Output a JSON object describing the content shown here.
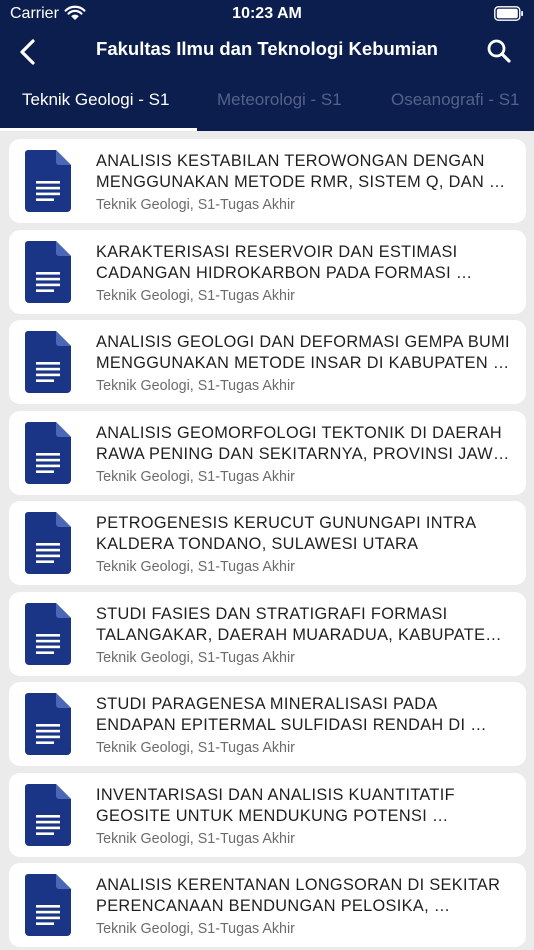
{
  "status_bar": {
    "carrier": "Carrier",
    "time": "10:23 AM"
  },
  "nav": {
    "title": "Fakultas Ilmu dan Teknologi Kebumian"
  },
  "tabs": [
    {
      "label": "Teknik Geologi - S1",
      "active": true
    },
    {
      "label": "Meteorologi - S1",
      "active": false
    },
    {
      "label": "Oseanografi - S1",
      "active": false
    }
  ],
  "colors": {
    "header_bg": "#0c1e4d",
    "doc_icon": "#1a3586",
    "list_bg": "#ebebeb"
  },
  "items": [
    {
      "title_line1": "ANALISIS KESTABILAN TEROWONGAN DENGAN",
      "title_line2": "MENGGUNAKAN METODE RMR, SISTEM Q, DAN …",
      "subtitle": "Teknik Geologi, S1-Tugas Akhir"
    },
    {
      "title_line1": "KARAKTERISASI RESERVOIR DAN ESTIMASI",
      "title_line2": "CADANGAN HIDROKARBON PADA FORMASI …",
      "subtitle": "Teknik Geologi, S1-Tugas Akhir"
    },
    {
      "title_line1": "ANALISIS GEOLOGI DAN DEFORMASI GEMPA BUMI",
      "title_line2": "MENGGUNAKAN METODE INSAR DI KABUPATEN …",
      "subtitle": "Teknik Geologi, S1-Tugas Akhir"
    },
    {
      "title_line1": "ANALISIS GEOMORFOLOGI TEKTONIK DI DAERAH",
      "title_line2": "RAWA PENING DAN SEKITARNYA, PROVINSI JAW…",
      "subtitle": "Teknik Geologi, S1-Tugas Akhir"
    },
    {
      "title_line1": "PETROGENESIS KERUCUT GUNUNGAPI INTRA",
      "title_line2": "KALDERA TONDANO, SULAWESI UTARA",
      "subtitle": "Teknik Geologi, S1-Tugas Akhir"
    },
    {
      "title_line1": "STUDI FASIES DAN STRATIGRAFI FORMASI",
      "title_line2": "TALANGAKAR, DAERAH MUARADUA, KABUPATE…",
      "subtitle": "Teknik Geologi, S1-Tugas Akhir"
    },
    {
      "title_line1": "STUDI PARAGENESA MINERALISASI PADA",
      "title_line2": "ENDAPAN EPITERMAL SULFIDASI RENDAH DI …",
      "subtitle": "Teknik Geologi, S1-Tugas Akhir"
    },
    {
      "title_line1": "INVENTARISASI DAN ANALISIS KUANTITATIF",
      "title_line2": "GEOSITE UNTUK MENDUKUNG POTENSI …",
      "subtitle": "Teknik Geologi, S1-Tugas Akhir"
    },
    {
      "title_line1": "ANALISIS KERENTANAN LONGSORAN DI SEKITAR",
      "title_line2": "PERENCANAAN BENDUNGAN PELOSIKA, …",
      "subtitle": "Teknik Geologi, S1-Tugas Akhir"
    }
  ]
}
